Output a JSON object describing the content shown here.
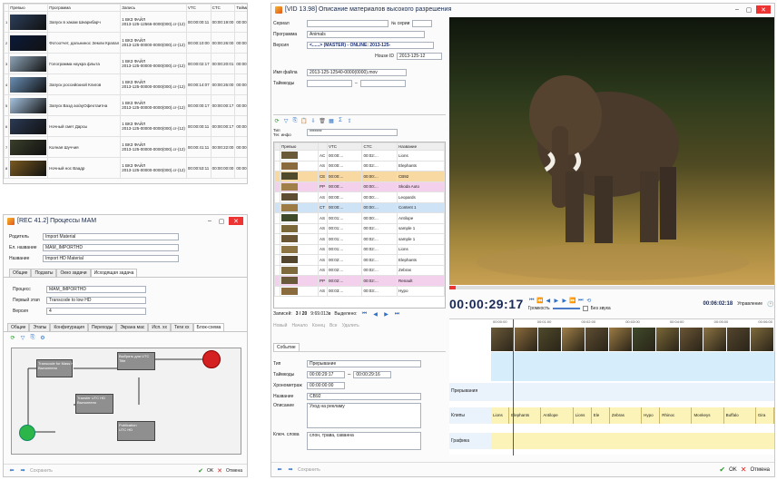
{
  "tl_window": {
    "headers": [
      "Превью",
      "Программа",
      "Запись",
      "VTC",
      "CTC",
      "Тайминг"
    ],
    "rows": [
      {
        "c": "#2c3e5a",
        "pg": "Запуск в хакам Шнарибарч",
        "rec": "1 ВКЗ ФАЙЛ\n2013-125-12566-0000(000).cr-(12)",
        "vtc": "00:00:00:11",
        "ctc": "00:00:19:00",
        "dur": "00:00:06:11"
      },
      {
        "c": "#0b1a3a",
        "pg": "Фотоотчет, дальнинос Земли Крапал",
        "rec": "1 ВКЗ ФАЙЛ\n2013-125-00000-0000(000).cr-(12)",
        "vtc": "00:00:10:00",
        "ctc": "00:00:26:00",
        "dur": "00:00:06:11"
      },
      {
        "c": "#8fa5b8",
        "pg": "Голограмма наукра флыта",
        "rec": "1 ВКЗ ФАЙЛ\n2013-125-00000-0000(000).cr-(12)",
        "vtc": "00:00:02:17",
        "ctc": "00:00:20:01",
        "dur": "00:00:06:11"
      },
      {
        "c": "#6a8fb5",
        "pg": "Запуск российскиой Клигов",
        "rec": "1 ВКЗ ФАЙЛ\n2013-125-00000-0000(000).cr-(12)",
        "vtc": "00:00:14:07",
        "ctc": "00:00:26:00",
        "dur": "00:00:04:00"
      },
      {
        "c": "#a7c4e0",
        "pg": "Запуск Ваэд ао/ауОфеотаитна",
        "rec": "1 ВКЗ ФАЙЛ\n2013-125-00000-0000(000).cr-(12)",
        "vtc": "00:00:00:17",
        "ctc": "00:00:00:17",
        "dur": "00:00:00:13"
      },
      {
        "c": "#2b3a55",
        "pg": "Ночный смет Дарсы",
        "rec": "1 ВКЗ ФАЙЛ\n2013-125-00000-0000(000).cr-(12)",
        "vtc": "00:00:00:11",
        "ctc": "00:00:00:17",
        "dur": "00:00:00:13"
      },
      {
        "c": "#3a3f2a",
        "pg": "Колная Шуччия",
        "rec": "1 ВКЗ ФАЙЛ\n2013-125-00000-0000(000).cr-(12)",
        "vtc": "00:00:41:11",
        "ctc": "00:00:22:00",
        "dur": "00:00:06:04"
      },
      {
        "c": "#7a5a20",
        "pg": "Ночный нос Ваадр",
        "rec": "1 ВКЗ ФАЙЛ\n2013-125-00000-0000(000).cr-(12)",
        "vtc": "00:00:53:11",
        "ctc": "00:00:00:00",
        "dur": "00:00:00:41"
      }
    ]
  },
  "bl_window": {
    "title": "[REC 41.2] Процессы MAM",
    "fields": [
      {
        "label": "Родитель",
        "value": "Import Material"
      },
      {
        "label": "Ел. название",
        "value": "MAM_IMPORTHD"
      },
      {
        "label": "Название",
        "value": "Import HD Material"
      }
    ],
    "tabs1": [
      "Общие",
      "Подзаты",
      "Окно задачи",
      "Исходящая задача"
    ],
    "fields2": [
      {
        "label": "Процесс",
        "value": "MAM_IMPORTHD"
      },
      {
        "label": "Первый этап",
        "value": "Transcode to low HD"
      },
      {
        "label": "Версия",
        "value": "4"
      }
    ],
    "tabs2": [
      "Общие",
      "Этапы",
      "Конфигурация",
      "Переходы",
      "Экрана мас",
      "Исп. хх",
      "Теги хх",
      "Блок-схема"
    ],
    "nodes": [
      "Transcode for Mass HD\nВыполнено",
      "Выбрать для UTC\nTitle",
      "Transfer UTC HD\nВыполнено",
      "Publication\nUTC HD"
    ],
    "bottom": {
      "save": "Сохранить",
      "ok": "OK",
      "cancel": "Отмена"
    }
  },
  "right_window": {
    "title": "[VID 13.98] Описание материалов высокого разрешения",
    "fields": [
      {
        "label": "Сериал",
        "value": "",
        "extra": "№ серии"
      },
      {
        "label": "Программа",
        "value": "Аnimals"
      },
      {
        "label": "Версия",
        "value": "<......> (MASTER) - ONLINE: 2013-125-"
      },
      {
        "label": "House ID",
        "value": "2013-125-12"
      },
      {
        "label": "Имя файла",
        "value": "2013-125-12540-0000(0000).mov"
      },
      {
        "label": "Таймкоды",
        "value": ""
      }
    ],
    "search_label": "Тип\nТег. инфо",
    "search_value": "*******",
    "list_headers": [
      "Превью",
      "",
      "VTC",
      "CTC",
      "Название"
    ],
    "list": [
      {
        "t": "AC",
        "vtc": "00:00:...",
        "ctc": "00:02:...",
        "name": "Lions",
        "cls": ""
      },
      {
        "t": "AS",
        "vtc": "00:00:...",
        "ctc": "00:02:...",
        "name": "Elephants",
        "cls": ""
      },
      {
        "t": "CE",
        "vtc": "00:00:...",
        "ctc": "00:00:...",
        "name": "CB92",
        "cls": "rowsel"
      },
      {
        "t": "PP",
        "vtc": "00:00:...",
        "ctc": "00:00:...",
        "name": "Skoda Auto",
        "cls": "rowpink"
      },
      {
        "t": "AS",
        "vtc": "00:00:...",
        "ctc": "00:00:...",
        "name": "Leopards",
        "cls": ""
      },
      {
        "t": "CT",
        "vtc": "00:00:...",
        "ctc": "00:00:...",
        "name": "Content 1",
        "cls": "rowblue"
      },
      {
        "t": "AS",
        "vtc": "00:01:...",
        "ctc": "00:00:...",
        "name": "Antilope",
        "cls": ""
      },
      {
        "t": "AS",
        "vtc": "00:01:...",
        "ctc": "00:02:...",
        "name": "sample 1",
        "cls": ""
      },
      {
        "t": "AS",
        "vtc": "00:01:...",
        "ctc": "00:02:...",
        "name": "sample 1",
        "cls": ""
      },
      {
        "t": "AS",
        "vtc": "00:01:...",
        "ctc": "00:02:...",
        "name": "Lions",
        "cls": ""
      },
      {
        "t": "AS",
        "vtc": "00:02:...",
        "ctc": "00:02:...",
        "name": "Elephants",
        "cls": ""
      },
      {
        "t": "AS",
        "vtc": "00:02:...",
        "ctc": "00:02:...",
        "name": "Zebras",
        "cls": ""
      },
      {
        "t": "PP",
        "vtc": "00:02:...",
        "ctc": "00:02:...",
        "name": "Renault",
        "cls": "rowpink"
      },
      {
        "t": "AS",
        "vtc": "00:03:...",
        "ctc": "00:03:...",
        "name": "Hypo",
        "cls": ""
      }
    ],
    "records": {
      "label": "Записей:",
      "count": "3 / 20",
      "dur": "9:69.013в",
      "sel": "Выделено:"
    },
    "actions": [
      "Новый",
      "Начало",
      "Конец",
      "Все",
      "Удалить"
    ],
    "event_tab": "Событие",
    "event": {
      "type_label": "Тип",
      "type": "Прерывание",
      "tc_label": "Таймкоды",
      "tc_in": "00:00:29:17",
      "tc_out": "00:00:29:16",
      "dur_label": "Хронометраж",
      "dur": "00:00:00:00",
      "name_label": "Название",
      "name": "CB92",
      "desc_label": "Описание",
      "desc": "Уход на рекламу",
      "keys_label": "Ключ. слова",
      "keys": "слон, трава, саванна"
    },
    "timecode": "00:00:29:17",
    "volume_label": "Громкость",
    "mute_label": "Без звука",
    "duration": "00:06:02:18",
    "control_label": "Управление",
    "ruler": [
      "00:00:00",
      "00:01:00",
      "00:02:00",
      "00:03:00",
      "00:04:00",
      "00:05:00",
      "00:06:00"
    ],
    "tracks": [
      "Прерывания",
      "Клипы",
      "Графика"
    ],
    "clips": [
      "Lions",
      "Elephants",
      "Antilope",
      "Lions",
      "Ele",
      "Zebras",
      "Hypo",
      "Rhinoc",
      "Monkeys",
      "Buffalo",
      "Gira"
    ],
    "bottom": {
      "save": "Сохранить",
      "ok": "OK",
      "cancel": "Отмена"
    }
  }
}
